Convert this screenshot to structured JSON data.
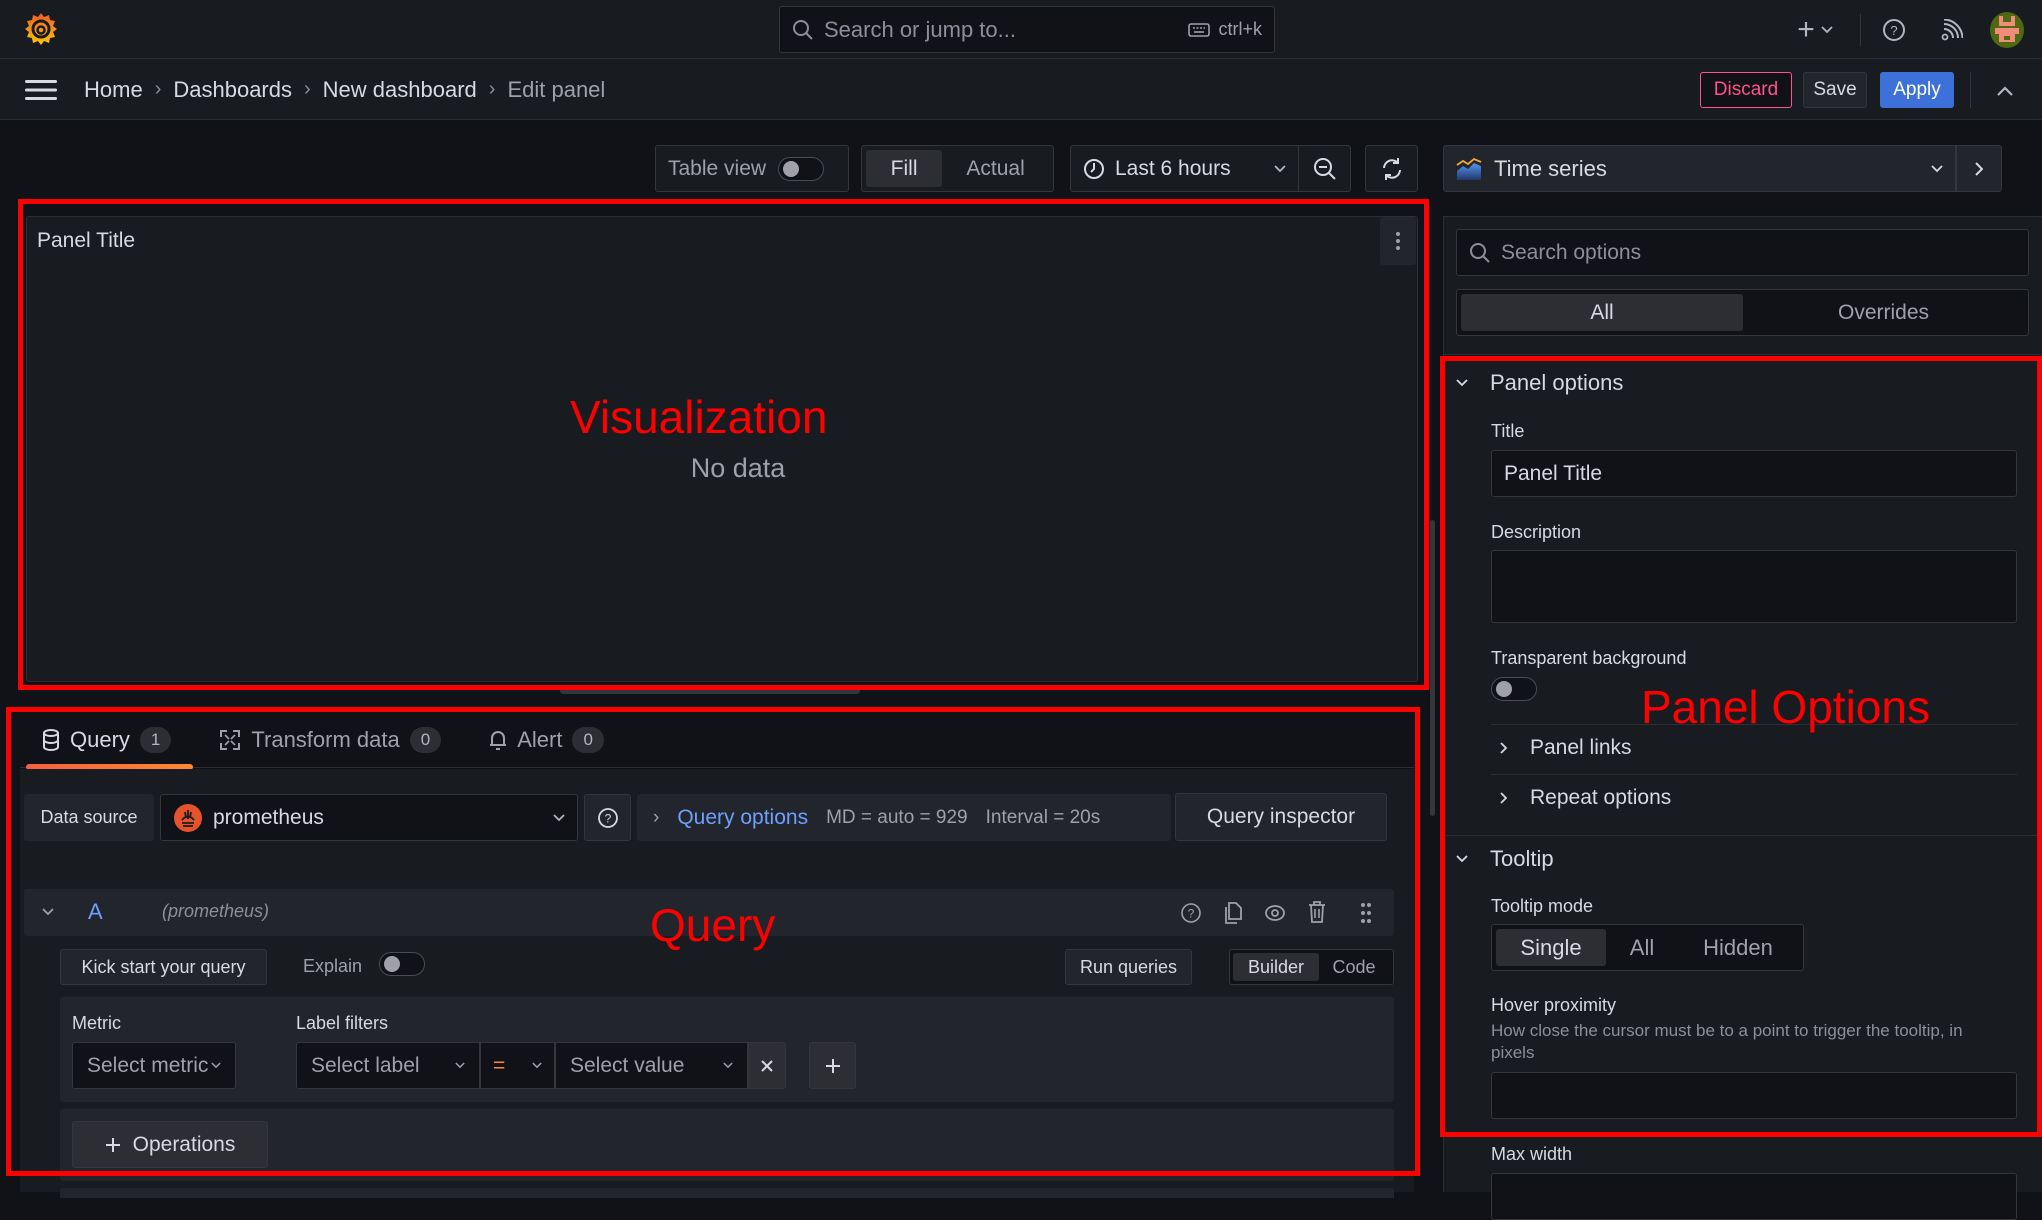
{
  "topbar": {
    "search_placeholder": "Search or jump to...",
    "search_shortcut": "ctrl+k",
    "icons": [
      "grafana-logo",
      "plus-icon",
      "help-icon",
      "news-icon",
      "avatar"
    ]
  },
  "breadcrumb": {
    "items": [
      "Home",
      "Dashboards",
      "New dashboard",
      "Edit panel"
    ]
  },
  "actions": {
    "discard": "Discard",
    "save": "Save",
    "apply": "Apply"
  },
  "toolbar": {
    "table_view": "Table view",
    "fill": "Fill",
    "actual": "Actual",
    "time_range": "Last 6 hours",
    "visualization": "Time series"
  },
  "panel": {
    "title": "Panel Title",
    "empty_message": "No data"
  },
  "annotations": {
    "visualization": "Visualization",
    "query": "Query",
    "panel_options": "Panel Options"
  },
  "query_tabs": [
    {
      "label": "Query",
      "count": "1"
    },
    {
      "label": "Transform data",
      "count": "0"
    },
    {
      "label": "Alert",
      "count": "0"
    }
  ],
  "query": {
    "datasource_label": "Data source",
    "datasource": "prometheus",
    "query_options": "Query options",
    "md": "MD = auto = 929",
    "interval": "Interval = 20s",
    "inspector": "Query inspector",
    "ref_id": "A",
    "ref_source": "(prometheus)",
    "kick_start": "Kick start your query",
    "explain": "Explain",
    "run_queries": "Run queries",
    "mode_builder": "Builder",
    "mode_code": "Code",
    "metric_label": "Metric",
    "metric_placeholder": "Select metric",
    "label_filters_label": "Label filters",
    "label_placeholder": "Select label",
    "operator": "=",
    "value_placeholder": "Select value",
    "operations": "Operations"
  },
  "options": {
    "search_placeholder": "Search options",
    "tab_all": "All",
    "tab_overrides": "Overrides",
    "panel_options": {
      "header": "Panel options",
      "title_label": "Title",
      "title_value": "Panel Title",
      "description_label": "Description",
      "description_value": "",
      "transparent_label": "Transparent background",
      "transparent": false,
      "panel_links": "Panel links",
      "repeat_options": "Repeat options"
    },
    "tooltip": {
      "header": "Tooltip",
      "mode_label": "Tooltip mode",
      "modes": [
        "Single",
        "All",
        "Hidden"
      ],
      "mode_selected": "Single",
      "hover_label": "Hover proximity",
      "hover_desc": "How close the cursor must be to a point to trigger the tooltip, in pixels",
      "hover_value": "",
      "max_width_label": "Max width"
    }
  },
  "colors": {
    "accent_blue": "#3d71d9",
    "link_blue": "#6e9fff",
    "discard_pink": "#ff5286",
    "tab_underline": "#ff7a33",
    "annotation_red": "#ff0000"
  }
}
